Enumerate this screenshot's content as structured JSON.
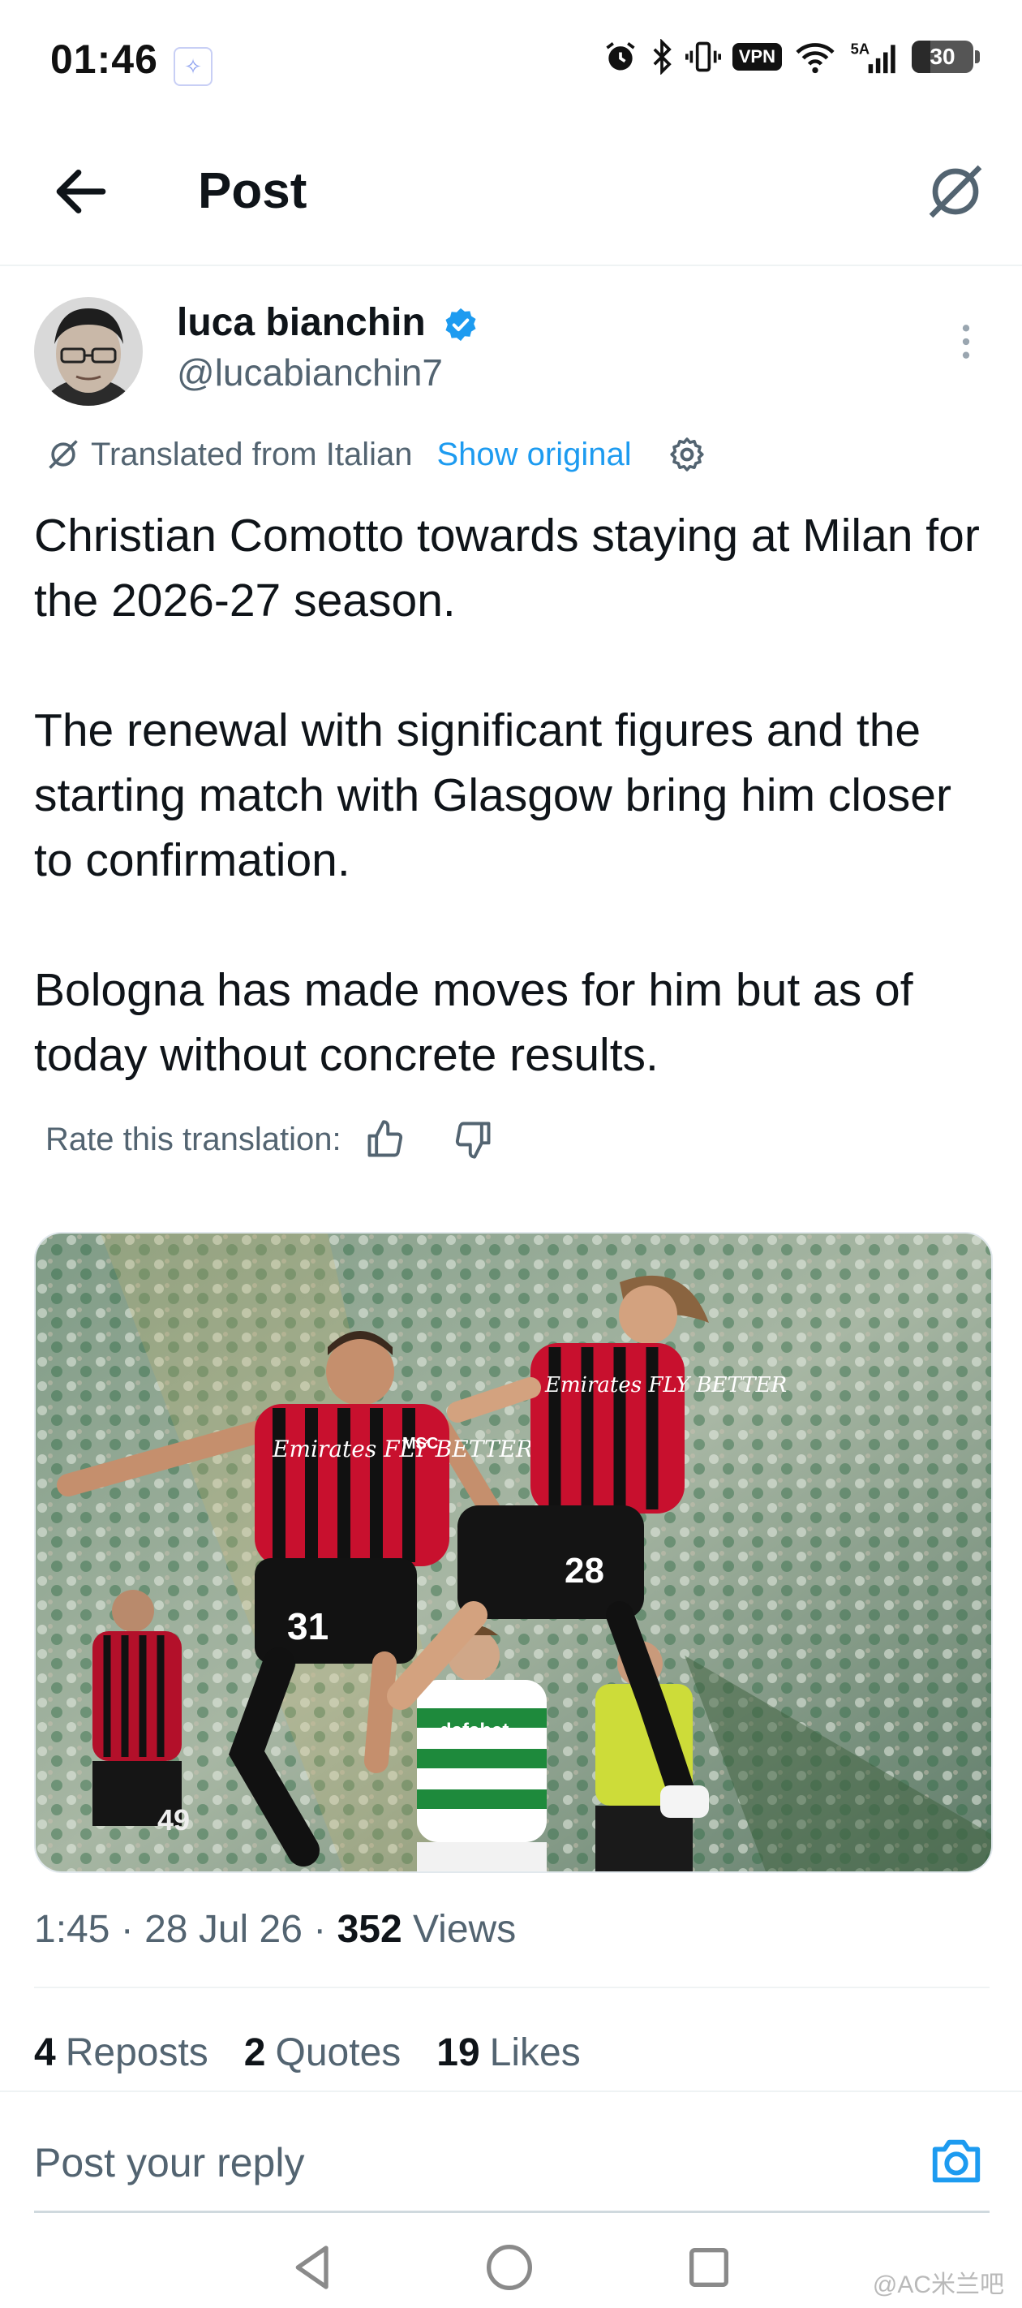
{
  "status_bar": {
    "time": "01:46",
    "vpn_label": "VPN",
    "battery_level": "30",
    "battery_fraction": 0.3,
    "icons": [
      "notification-icon",
      "alarm-icon",
      "bluetooth-icon",
      "vibrate-icon",
      "vpn-icon",
      "wifi-icon",
      "cellular-5a-icon",
      "battery-icon"
    ]
  },
  "header": {
    "title": "Post",
    "back_icon": "arrow-left-icon",
    "grok_icon": "grok-icon"
  },
  "post": {
    "author": {
      "name": "luca bianchin",
      "handle": "@lucabianchin7",
      "verified": true
    },
    "translation": {
      "label": "Translated from Italian",
      "show_original": "Show original",
      "rate_label": "Rate this translation:"
    },
    "text_paragraphs": [
      "Christian Comotto towards staying at Milan for the 2026-27 season.",
      "The renewal with significant figures and the starting match with Glasgow bring him closer to confirmation.",
      "Bologna has made moves for him but as of today without concrete results."
    ],
    "image": {
      "jersey_text_1": "Emirates FLY BETTER",
      "jersey_text_2": "Emirates FLY BETTER",
      "number_1": "31",
      "number_2": "28",
      "number_3": "49",
      "sponsor_celtic": "dafabet",
      "msc": "MSC"
    },
    "meta": {
      "time": "1:45",
      "date": "28 Jul 26",
      "views_count": "352",
      "views_label": "Views"
    },
    "stats": {
      "reposts_count": "4",
      "reposts_label": "Reposts",
      "quotes_count": "2",
      "quotes_label": "Quotes",
      "likes_count": "19",
      "likes_label": "Likes"
    }
  },
  "reply": {
    "placeholder": "Post your reply"
  },
  "watermark": "@AC米兰吧",
  "colors": {
    "accent": "#1d9bf0",
    "text_primary": "#0f1419",
    "text_secondary": "#536471",
    "milan_red": "#c8102e",
    "celtic_green": "#1e8a3c"
  }
}
